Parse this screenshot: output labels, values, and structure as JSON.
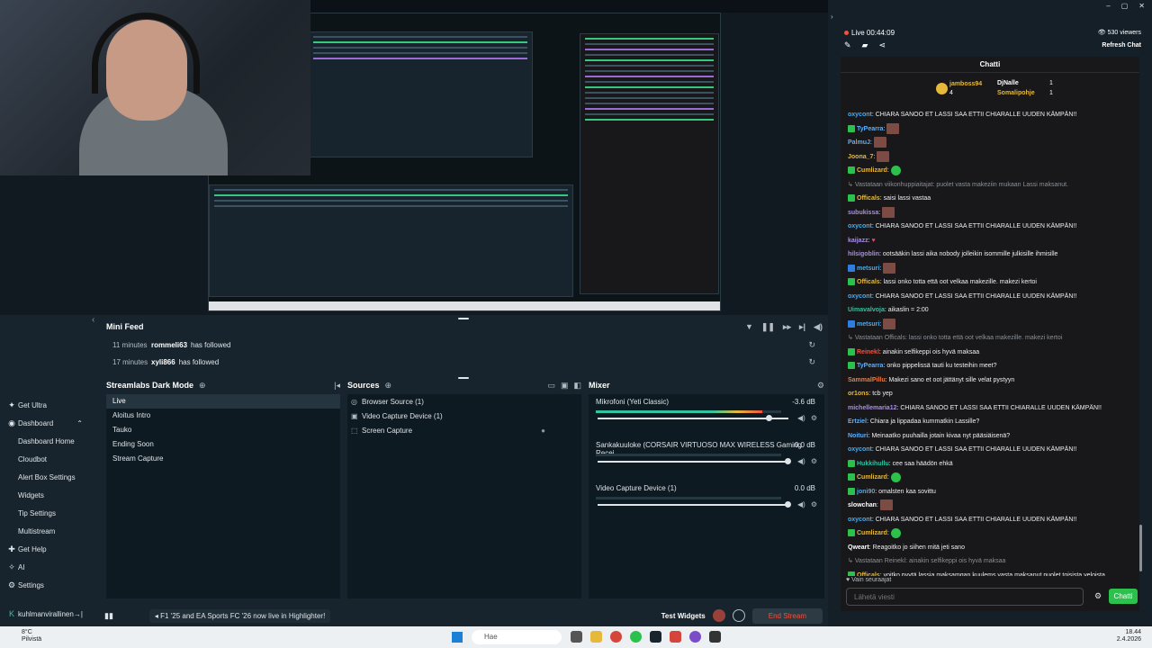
{
  "webcam": {
    "label": "webcam"
  },
  "minifeed": {
    "title": "Mini Feed",
    "items": [
      {
        "time": "11 minutes",
        "user": "rommeli63",
        "action": "has followed"
      },
      {
        "time": "17 minutes",
        "user": "xyli866",
        "action": "has followed"
      }
    ]
  },
  "scenes": {
    "title": "Streamlabs Dark Mode",
    "items": [
      "Live",
      "Aloitus Intro",
      "Tauko",
      "Ending Soon",
      "Stream Capture"
    ],
    "active": 0
  },
  "sources": {
    "title": "Sources",
    "items": [
      "Browser Source (1)",
      "Video Capture Device (1)",
      "Screen Capture"
    ]
  },
  "mixer": {
    "title": "Mixer",
    "items": [
      {
        "name": "Mikrofoni (Yeti Classic)",
        "db": "-3.6 dB",
        "level": 0.9,
        "volume": 0.9
      },
      {
        "name": "Sankakuuloke (CORSAIR VIRTUOSO MAX WIRELESS Gaming Recei...",
        "db": "0.0 dB",
        "level": 0.0,
        "volume": 1.0
      },
      {
        "name": "Video Capture Device (1)",
        "db": "0.0 dB",
        "level": 0.0,
        "volume": 1.0
      }
    ]
  },
  "nav": {
    "items": [
      {
        "label": "Get Ultra",
        "icon": "gift-icon",
        "sub": false
      },
      {
        "label": "Dashboard",
        "icon": "dashboard-icon",
        "sub": false,
        "expanded": true
      },
      {
        "label": "Dashboard Home",
        "sub": true
      },
      {
        "label": "Cloudbot",
        "sub": true
      },
      {
        "label": "Alert Box Settings",
        "sub": true
      },
      {
        "label": "Widgets",
        "sub": true
      },
      {
        "label": "Tip Settings",
        "sub": true
      },
      {
        "label": "Multistream",
        "sub": true
      },
      {
        "label": "Get Help",
        "icon": "help-icon",
        "sub": false
      },
      {
        "label": "AI",
        "icon": "ai-icon",
        "sub": false
      },
      {
        "label": "Settings",
        "icon": "gear-icon",
        "sub": false
      }
    ],
    "user": "kuhlmanvirallinen"
  },
  "footer": {
    "ticker": "F1 '25 and EA Sports FC '26 now live in Highlighter!",
    "test_widgets": "Test Widgets",
    "end_stream": "End Stream"
  },
  "chat": {
    "live": "Live 00:44:09",
    "viewers": "530 viewers",
    "refresh": "Refresh Chat",
    "title": "Chatti",
    "leaders": {
      "first": {
        "name": "jamboss94",
        "count": "4"
      },
      "second": {
        "name": "DjNalle",
        "count": "1"
      },
      "third": {
        "name": "Somalipohje",
        "count": "1"
      }
    },
    "messages": [
      {
        "user": "oxycont",
        "color": "#3ab1ff",
        "text": "CHIARA SANOO ET LASSI SAA ETTII CHIARALLE UUDEN KÄMPÄN!!"
      },
      {
        "user": "TyPearra",
        "color": "#5ab0ff",
        "text": "",
        "emote": "img",
        "badge": "#2cc04c"
      },
      {
        "user": "PalmuJ",
        "color": "#5ab0ff",
        "text": "",
        "emote": "img"
      },
      {
        "user": "Joona_7",
        "color": "#e6b93a",
        "text": "",
        "emote": "img"
      },
      {
        "user": "Cumlizard",
        "color": "#e6b93a",
        "text": "",
        "emote": "green",
        "badge": "#2cc04c"
      },
      {
        "note": true,
        "text": "Vastataan viikonhuppiaitajat: puolet vasta makeziin mukaan Lassi maksanut."
      },
      {
        "user": "Officals",
        "color": "#e6b93a",
        "text": "saisi lassi vastaa",
        "badge": "#2cc04c"
      },
      {
        "user": "subukissa",
        "color": "#a98ce8",
        "text": "",
        "emote": "img"
      },
      {
        "user": "oxycont",
        "color": "#3ab1ff",
        "text": "CHIARA SANOO ET LASSI SAA ETTII CHIARALLE UUDEN KÄMPÄN!!"
      },
      {
        "user": "kaijazz",
        "color": "#a98ce8",
        "text": "",
        "emote": "heart"
      },
      {
        "user": "hilsigoblin",
        "color": "#a98ce8",
        "text": "ootsääkin lassi aika nobody jolleikin isommille julkisille ihmisille"
      },
      {
        "user": "metsuri",
        "color": "#3ab1ff",
        "text": "",
        "emote": "img",
        "badge": "#2f7de0"
      },
      {
        "user": "Officals",
        "color": "#e6b93a",
        "text": "lassi onko totta että oot velkaa makezille. makezi kertoi",
        "badge": "#2cc04c"
      },
      {
        "user": "oxycont",
        "color": "#3ab1ff",
        "text": "CHIARA SANOO ET LASSI SAA ETTII CHIARALLE UUDEN KÄMPÄN!!"
      },
      {
        "user": "Uimavalvoja",
        "color": "#31c3a2",
        "text": "aikaslin = 2:00"
      },
      {
        "user": "metsuri",
        "color": "#3ab1ff",
        "text": "",
        "emote": "img",
        "badge": "#2f7de0"
      },
      {
        "note": true,
        "text": "Vastataan Officals: lassi onko totta että oot velkaa makezille. makezi kertoi"
      },
      {
        "user": "Reinekl",
        "color": "#f0533f",
        "text": "ainakin selfikeppi ois hyvä maksaa",
        "badge": "#2cc04c"
      },
      {
        "user": "TyPearra",
        "color": "#5ab0ff",
        "text": "onko pippelissä tauti ku testeihin meet?",
        "badge": "#2cc04c"
      },
      {
        "user": "SammalPillu",
        "color": "#f07a3a",
        "text": "Makezi sano et oot jättänyt sille velat pystyyn"
      },
      {
        "user": "or1ons",
        "color": "#e6b93a",
        "text": "tcb yep"
      },
      {
        "user": "michellemaria12",
        "color": "#a98ce8",
        "text": "CHIARA SANOO ET LASSI SAA ETTII CHIARALLE UUDEN KÄMPÄN!!"
      },
      {
        "user": "Ertziel",
        "color": "#5ab0ff",
        "text": "Chiara ja lippadaa kummatkin Lassille?"
      },
      {
        "user": "Noituri",
        "color": "#5ab0ff",
        "text": "Meinaatko puuhailla jotain kivaa nyt pääsiäisenä?"
      },
      {
        "user": "oxycont",
        "color": "#3ab1ff",
        "text": "CHIARA SANOO ET LASSI SAA ETTII CHIARALLE UUDEN KÄMPÄN!!"
      },
      {
        "user": "Hukkihullu",
        "color": "#31c3a2",
        "text": "cee saa häädön ehkä",
        "badge": "#2cc04c"
      },
      {
        "user": "Cumlizard",
        "color": "#e6b93a",
        "text": "",
        "emote": "green",
        "badge": "#2cc04c"
      },
      {
        "user": "joni90",
        "color": "#3ab1ff",
        "text": "omalsten kaa sovittu",
        "badge": "#2cc04c"
      },
      {
        "user": "slowchan",
        "color": "#fff",
        "text": "",
        "emote": "img"
      },
      {
        "user": "oxycont",
        "color": "#3ab1ff",
        "text": "CHIARA SANOO ET LASSI SAA ETTII CHIARALLE UUDEN KÄMPÄN!!"
      },
      {
        "user": "Cumlizard",
        "color": "#e6b93a",
        "text": "",
        "emote": "green",
        "badge": "#2cc04c"
      },
      {
        "user": "Qweart",
        "color": "#fff",
        "text": "Reagoitko jo siihen mitä jeti sano"
      },
      {
        "note": true,
        "text": "Vastataan Reinekl: ainakin selfikeppi ois hyvä maksaa"
      },
      {
        "user": "Officals",
        "color": "#e6b93a",
        "text": "voitko pyytä lassia maksamqan kuulems vasta maksanut puolet toisista veloista",
        "badge": "#2cc04c"
      }
    ],
    "only_followers": "Vain seuraajat",
    "input_placeholder": "Lähetä viesti",
    "send": "Chatti"
  },
  "taskbar": {
    "temp": "8°C",
    "weather": "Pilvistä",
    "search": "Hae",
    "time": "18.44",
    "date": "2.4.2026"
  }
}
